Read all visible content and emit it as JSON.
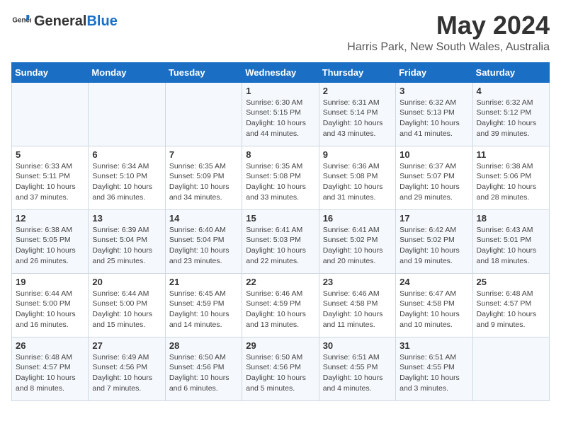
{
  "header": {
    "logo_general": "General",
    "logo_blue": "Blue",
    "month": "May 2024",
    "location": "Harris Park, New South Wales, Australia"
  },
  "weekdays": [
    "Sunday",
    "Monday",
    "Tuesday",
    "Wednesday",
    "Thursday",
    "Friday",
    "Saturday"
  ],
  "weeks": [
    [
      {
        "day": "",
        "detail": ""
      },
      {
        "day": "",
        "detail": ""
      },
      {
        "day": "",
        "detail": ""
      },
      {
        "day": "1",
        "detail": "Sunrise: 6:30 AM\nSunset: 5:15 PM\nDaylight: 10 hours\nand 44 minutes."
      },
      {
        "day": "2",
        "detail": "Sunrise: 6:31 AM\nSunset: 5:14 PM\nDaylight: 10 hours\nand 43 minutes."
      },
      {
        "day": "3",
        "detail": "Sunrise: 6:32 AM\nSunset: 5:13 PM\nDaylight: 10 hours\nand 41 minutes."
      },
      {
        "day": "4",
        "detail": "Sunrise: 6:32 AM\nSunset: 5:12 PM\nDaylight: 10 hours\nand 39 minutes."
      }
    ],
    [
      {
        "day": "5",
        "detail": "Sunrise: 6:33 AM\nSunset: 5:11 PM\nDaylight: 10 hours\nand 37 minutes."
      },
      {
        "day": "6",
        "detail": "Sunrise: 6:34 AM\nSunset: 5:10 PM\nDaylight: 10 hours\nand 36 minutes."
      },
      {
        "day": "7",
        "detail": "Sunrise: 6:35 AM\nSunset: 5:09 PM\nDaylight: 10 hours\nand 34 minutes."
      },
      {
        "day": "8",
        "detail": "Sunrise: 6:35 AM\nSunset: 5:08 PM\nDaylight: 10 hours\nand 33 minutes."
      },
      {
        "day": "9",
        "detail": "Sunrise: 6:36 AM\nSunset: 5:08 PM\nDaylight: 10 hours\nand 31 minutes."
      },
      {
        "day": "10",
        "detail": "Sunrise: 6:37 AM\nSunset: 5:07 PM\nDaylight: 10 hours\nand 29 minutes."
      },
      {
        "day": "11",
        "detail": "Sunrise: 6:38 AM\nSunset: 5:06 PM\nDaylight: 10 hours\nand 28 minutes."
      }
    ],
    [
      {
        "day": "12",
        "detail": "Sunrise: 6:38 AM\nSunset: 5:05 PM\nDaylight: 10 hours\nand 26 minutes."
      },
      {
        "day": "13",
        "detail": "Sunrise: 6:39 AM\nSunset: 5:04 PM\nDaylight: 10 hours\nand 25 minutes."
      },
      {
        "day": "14",
        "detail": "Sunrise: 6:40 AM\nSunset: 5:04 PM\nDaylight: 10 hours\nand 23 minutes."
      },
      {
        "day": "15",
        "detail": "Sunrise: 6:41 AM\nSunset: 5:03 PM\nDaylight: 10 hours\nand 22 minutes."
      },
      {
        "day": "16",
        "detail": "Sunrise: 6:41 AM\nSunset: 5:02 PM\nDaylight: 10 hours\nand 20 minutes."
      },
      {
        "day": "17",
        "detail": "Sunrise: 6:42 AM\nSunset: 5:02 PM\nDaylight: 10 hours\nand 19 minutes."
      },
      {
        "day": "18",
        "detail": "Sunrise: 6:43 AM\nSunset: 5:01 PM\nDaylight: 10 hours\nand 18 minutes."
      }
    ],
    [
      {
        "day": "19",
        "detail": "Sunrise: 6:44 AM\nSunset: 5:00 PM\nDaylight: 10 hours\nand 16 minutes."
      },
      {
        "day": "20",
        "detail": "Sunrise: 6:44 AM\nSunset: 5:00 PM\nDaylight: 10 hours\nand 15 minutes."
      },
      {
        "day": "21",
        "detail": "Sunrise: 6:45 AM\nSunset: 4:59 PM\nDaylight: 10 hours\nand 14 minutes."
      },
      {
        "day": "22",
        "detail": "Sunrise: 6:46 AM\nSunset: 4:59 PM\nDaylight: 10 hours\nand 13 minutes."
      },
      {
        "day": "23",
        "detail": "Sunrise: 6:46 AM\nSunset: 4:58 PM\nDaylight: 10 hours\nand 11 minutes."
      },
      {
        "day": "24",
        "detail": "Sunrise: 6:47 AM\nSunset: 4:58 PM\nDaylight: 10 hours\nand 10 minutes."
      },
      {
        "day": "25",
        "detail": "Sunrise: 6:48 AM\nSunset: 4:57 PM\nDaylight: 10 hours\nand 9 minutes."
      }
    ],
    [
      {
        "day": "26",
        "detail": "Sunrise: 6:48 AM\nSunset: 4:57 PM\nDaylight: 10 hours\nand 8 minutes."
      },
      {
        "day": "27",
        "detail": "Sunrise: 6:49 AM\nSunset: 4:56 PM\nDaylight: 10 hours\nand 7 minutes."
      },
      {
        "day": "28",
        "detail": "Sunrise: 6:50 AM\nSunset: 4:56 PM\nDaylight: 10 hours\nand 6 minutes."
      },
      {
        "day": "29",
        "detail": "Sunrise: 6:50 AM\nSunset: 4:56 PM\nDaylight: 10 hours\nand 5 minutes."
      },
      {
        "day": "30",
        "detail": "Sunrise: 6:51 AM\nSunset: 4:55 PM\nDaylight: 10 hours\nand 4 minutes."
      },
      {
        "day": "31",
        "detail": "Sunrise: 6:51 AM\nSunset: 4:55 PM\nDaylight: 10 hours\nand 3 minutes."
      },
      {
        "day": "",
        "detail": ""
      }
    ]
  ]
}
